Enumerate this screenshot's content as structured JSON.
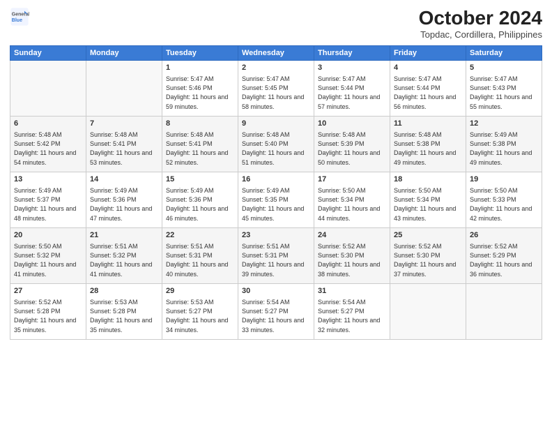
{
  "header": {
    "logo_line1": "General",
    "logo_line2": "Blue",
    "title": "October 2024",
    "location": "Topdac, Cordillera, Philippines"
  },
  "days_of_week": [
    "Sunday",
    "Monday",
    "Tuesday",
    "Wednesday",
    "Thursday",
    "Friday",
    "Saturday"
  ],
  "weeks": [
    [
      {
        "day": "",
        "info": ""
      },
      {
        "day": "",
        "info": ""
      },
      {
        "day": "1",
        "info": "Sunrise: 5:47 AM\nSunset: 5:46 PM\nDaylight: 11 hours and 59 minutes."
      },
      {
        "day": "2",
        "info": "Sunrise: 5:47 AM\nSunset: 5:45 PM\nDaylight: 11 hours and 58 minutes."
      },
      {
        "day": "3",
        "info": "Sunrise: 5:47 AM\nSunset: 5:44 PM\nDaylight: 11 hours and 57 minutes."
      },
      {
        "day": "4",
        "info": "Sunrise: 5:47 AM\nSunset: 5:44 PM\nDaylight: 11 hours and 56 minutes."
      },
      {
        "day": "5",
        "info": "Sunrise: 5:47 AM\nSunset: 5:43 PM\nDaylight: 11 hours and 55 minutes."
      }
    ],
    [
      {
        "day": "6",
        "info": "Sunrise: 5:48 AM\nSunset: 5:42 PM\nDaylight: 11 hours and 54 minutes."
      },
      {
        "day": "7",
        "info": "Sunrise: 5:48 AM\nSunset: 5:41 PM\nDaylight: 11 hours and 53 minutes."
      },
      {
        "day": "8",
        "info": "Sunrise: 5:48 AM\nSunset: 5:41 PM\nDaylight: 11 hours and 52 minutes."
      },
      {
        "day": "9",
        "info": "Sunrise: 5:48 AM\nSunset: 5:40 PM\nDaylight: 11 hours and 51 minutes."
      },
      {
        "day": "10",
        "info": "Sunrise: 5:48 AM\nSunset: 5:39 PM\nDaylight: 11 hours and 50 minutes."
      },
      {
        "day": "11",
        "info": "Sunrise: 5:48 AM\nSunset: 5:38 PM\nDaylight: 11 hours and 49 minutes."
      },
      {
        "day": "12",
        "info": "Sunrise: 5:49 AM\nSunset: 5:38 PM\nDaylight: 11 hours and 49 minutes."
      }
    ],
    [
      {
        "day": "13",
        "info": "Sunrise: 5:49 AM\nSunset: 5:37 PM\nDaylight: 11 hours and 48 minutes."
      },
      {
        "day": "14",
        "info": "Sunrise: 5:49 AM\nSunset: 5:36 PM\nDaylight: 11 hours and 47 minutes."
      },
      {
        "day": "15",
        "info": "Sunrise: 5:49 AM\nSunset: 5:36 PM\nDaylight: 11 hours and 46 minutes."
      },
      {
        "day": "16",
        "info": "Sunrise: 5:49 AM\nSunset: 5:35 PM\nDaylight: 11 hours and 45 minutes."
      },
      {
        "day": "17",
        "info": "Sunrise: 5:50 AM\nSunset: 5:34 PM\nDaylight: 11 hours and 44 minutes."
      },
      {
        "day": "18",
        "info": "Sunrise: 5:50 AM\nSunset: 5:34 PM\nDaylight: 11 hours and 43 minutes."
      },
      {
        "day": "19",
        "info": "Sunrise: 5:50 AM\nSunset: 5:33 PM\nDaylight: 11 hours and 42 minutes."
      }
    ],
    [
      {
        "day": "20",
        "info": "Sunrise: 5:50 AM\nSunset: 5:32 PM\nDaylight: 11 hours and 41 minutes."
      },
      {
        "day": "21",
        "info": "Sunrise: 5:51 AM\nSunset: 5:32 PM\nDaylight: 11 hours and 41 minutes."
      },
      {
        "day": "22",
        "info": "Sunrise: 5:51 AM\nSunset: 5:31 PM\nDaylight: 11 hours and 40 minutes."
      },
      {
        "day": "23",
        "info": "Sunrise: 5:51 AM\nSunset: 5:31 PM\nDaylight: 11 hours and 39 minutes."
      },
      {
        "day": "24",
        "info": "Sunrise: 5:52 AM\nSunset: 5:30 PM\nDaylight: 11 hours and 38 minutes."
      },
      {
        "day": "25",
        "info": "Sunrise: 5:52 AM\nSunset: 5:30 PM\nDaylight: 11 hours and 37 minutes."
      },
      {
        "day": "26",
        "info": "Sunrise: 5:52 AM\nSunset: 5:29 PM\nDaylight: 11 hours and 36 minutes."
      }
    ],
    [
      {
        "day": "27",
        "info": "Sunrise: 5:52 AM\nSunset: 5:28 PM\nDaylight: 11 hours and 35 minutes."
      },
      {
        "day": "28",
        "info": "Sunrise: 5:53 AM\nSunset: 5:28 PM\nDaylight: 11 hours and 35 minutes."
      },
      {
        "day": "29",
        "info": "Sunrise: 5:53 AM\nSunset: 5:27 PM\nDaylight: 11 hours and 34 minutes."
      },
      {
        "day": "30",
        "info": "Sunrise: 5:54 AM\nSunset: 5:27 PM\nDaylight: 11 hours and 33 minutes."
      },
      {
        "day": "31",
        "info": "Sunrise: 5:54 AM\nSunset: 5:27 PM\nDaylight: 11 hours and 32 minutes."
      },
      {
        "day": "",
        "info": ""
      },
      {
        "day": "",
        "info": ""
      }
    ]
  ]
}
